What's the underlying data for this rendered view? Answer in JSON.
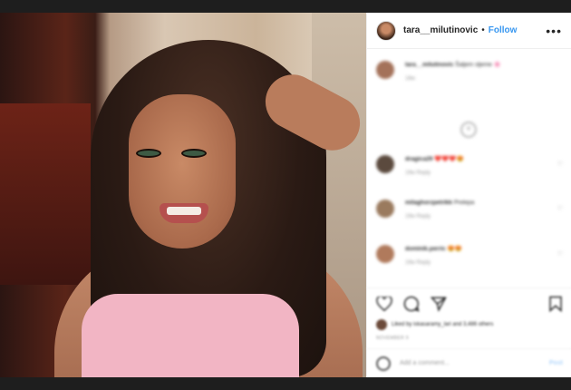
{
  "post": {
    "username": "tara__milutinovic",
    "separator": "•",
    "follow_label": "Follow",
    "more_icon": "more-options-icon",
    "more_glyph": "•••"
  },
  "comments": {
    "load_more_glyph": "+",
    "items": [
      {
        "user": "tara__milutinovic",
        "text": "Šaljem sljeme 🌸",
        "meta": "18w"
      },
      {
        "user": "dragica29",
        "text": "❤️❤️❤️😍",
        "meta": "19w   Reply"
      },
      {
        "user": "milaghorzpetrikk",
        "text": "Prelepa",
        "meta": "19w   Reply"
      },
      {
        "user": "dominik.perric",
        "text": "😍😍",
        "meta": "19w   Reply"
      }
    ]
  },
  "actions": {
    "likes_text": "Liked by iskasaramy_lari and 3,486 others",
    "date_text": "NOVEMBER 9",
    "add_comment_placeholder": "Add a comment...",
    "post_label": "Post"
  }
}
